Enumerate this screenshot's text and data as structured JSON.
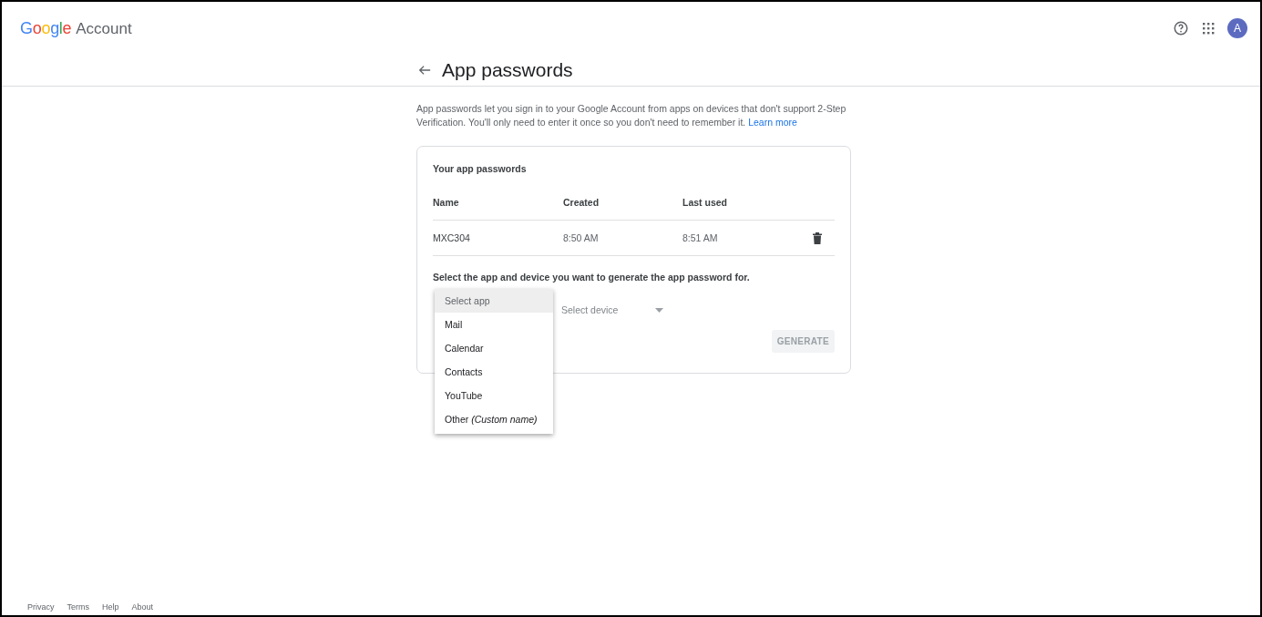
{
  "header": {
    "logo": "Google",
    "product": "Account",
    "avatar": "A"
  },
  "page": {
    "title": "App passwords",
    "intro": "App passwords let you sign in to your Google Account from apps on devices that don't support 2-Step Verification. You'll only need to enter it once so you don't need to remember it.",
    "learn_more": "Learn more"
  },
  "card": {
    "title": "Your app passwords",
    "columns": [
      "Name",
      "Created",
      "Last used"
    ],
    "rows": [
      {
        "name": "MXC304",
        "created": "8:50 AM",
        "last_used": "8:51 AM"
      }
    ],
    "prompt": "Select the app and device you want to generate the app password for.",
    "device_select": {
      "placeholder": "Select device"
    },
    "generate": {
      "label": "GENERATE",
      "disabled": true
    }
  },
  "app_menu": [
    {
      "label": "Select app",
      "selected": true
    },
    {
      "label": "Mail",
      "selected": false
    },
    {
      "label": "Calendar",
      "selected": false
    },
    {
      "label": "Contacts",
      "selected": false
    },
    {
      "label": "YouTube",
      "selected": false
    },
    {
      "label": "Other *(Custom name)*",
      "selected": false
    }
  ],
  "footer": [
    "Privacy",
    "Terms",
    "Help",
    "About"
  ]
}
